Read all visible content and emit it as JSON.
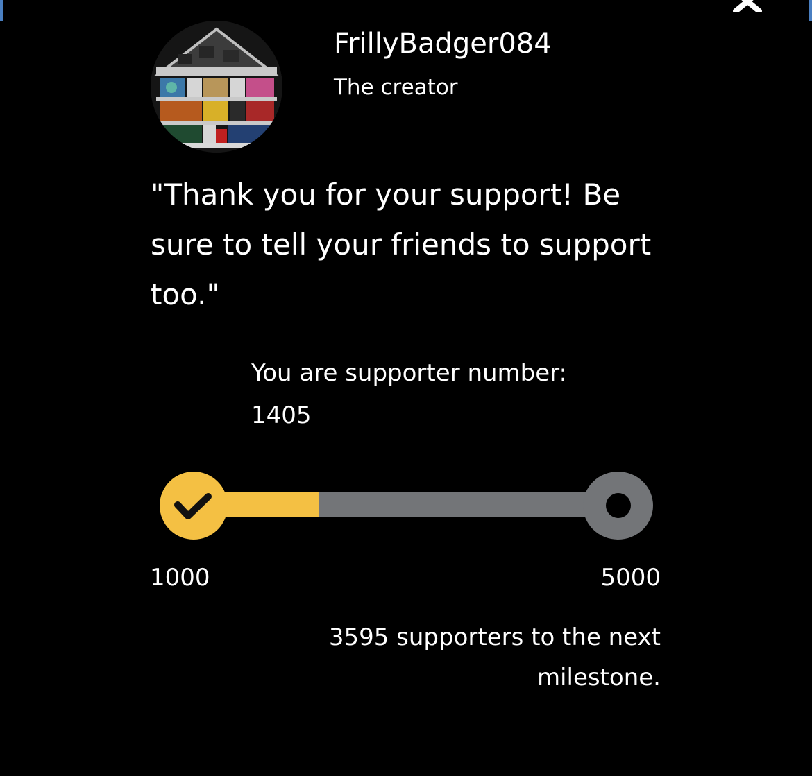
{
  "creator": {
    "name": "FrillyBadger084",
    "role": "The creator"
  },
  "message": {
    "quote": "\"Thank you for your support! Be sure to tell your friends to support too.\""
  },
  "supporter": {
    "label": "You are supporter number:",
    "number": "1405"
  },
  "milestone": {
    "start": "1000",
    "end": "5000",
    "progress_fraction": 0.26,
    "remaining_text": "3595 supporters to the next milestone."
  },
  "icons": {
    "close": "close-icon",
    "check": "check-icon",
    "avatar": "house-image"
  },
  "colors": {
    "background": "#000000",
    "accent": "#f4c043",
    "track": "#737578",
    "edge": "#4a7fc1"
  }
}
